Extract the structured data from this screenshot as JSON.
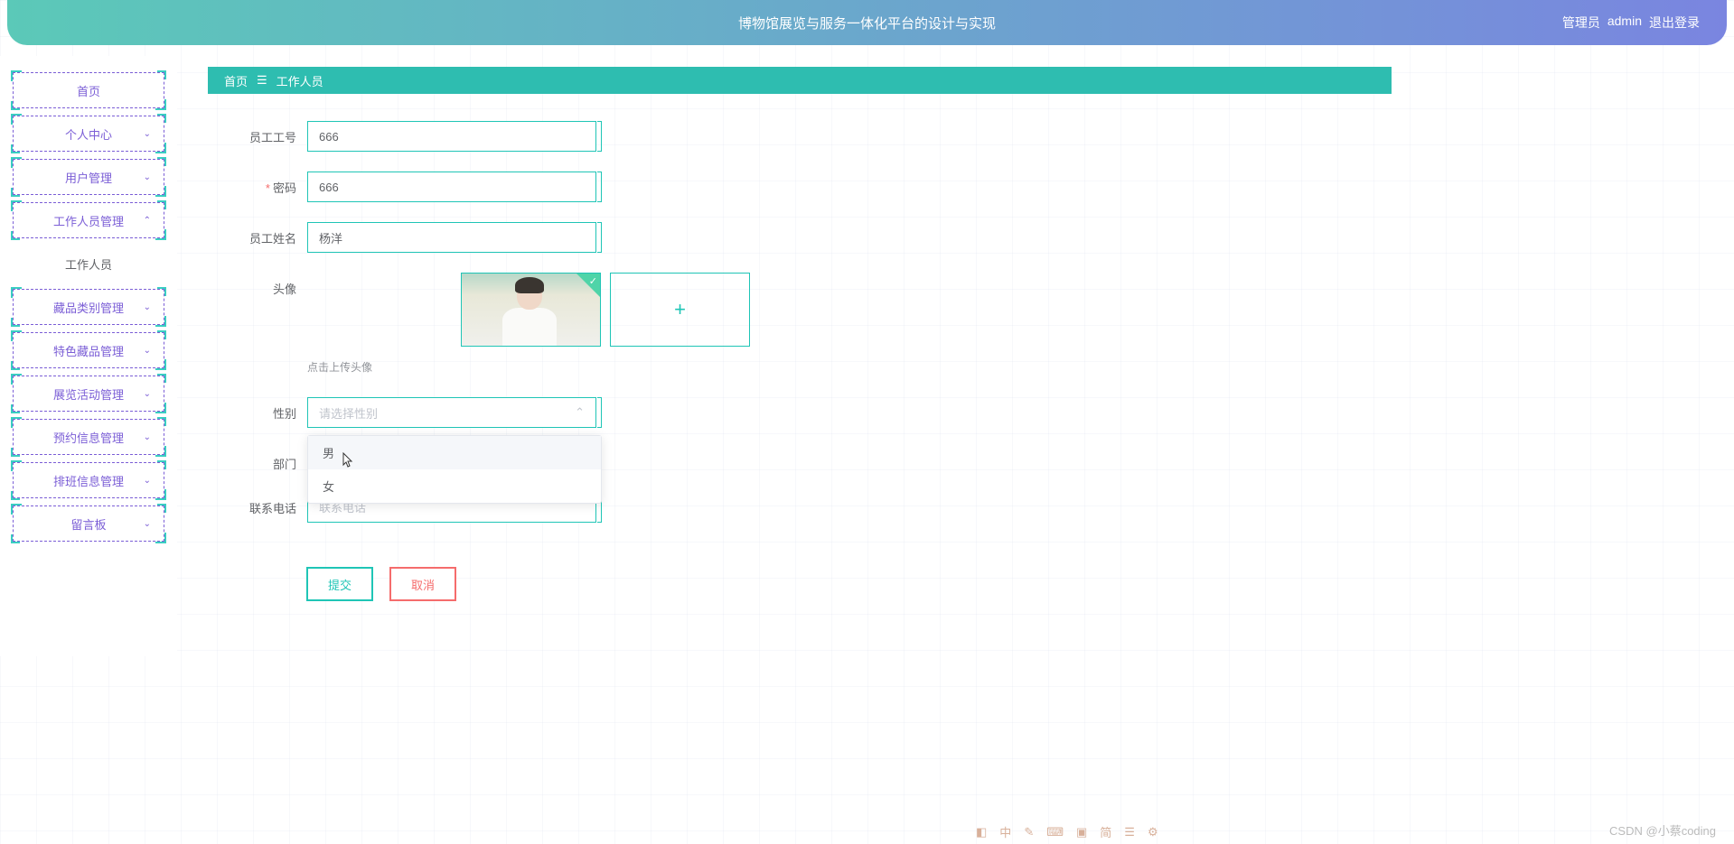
{
  "header": {
    "title": "博物馆展览与服务一体化平台的设计与实现",
    "role_label": "管理员",
    "username": "admin",
    "logout": "退出登录"
  },
  "sidebar": {
    "items": [
      {
        "label": "首页",
        "expandable": false
      },
      {
        "label": "个人中心",
        "expandable": true
      },
      {
        "label": "用户管理",
        "expandable": true
      },
      {
        "label": "工作人员管理",
        "expandable": true,
        "expanded": true
      },
      {
        "label": "工作人员",
        "expandable": false,
        "active": true
      },
      {
        "label": "藏品类别管理",
        "expandable": true
      },
      {
        "label": "特色藏品管理",
        "expandable": true
      },
      {
        "label": "展览活动管理",
        "expandable": true
      },
      {
        "label": "预约信息管理",
        "expandable": true
      },
      {
        "label": "排班信息管理",
        "expandable": true
      },
      {
        "label": "留言板",
        "expandable": true
      }
    ]
  },
  "breadcrumb": {
    "home": "首页",
    "sep": "☰",
    "current": "工作人员"
  },
  "form": {
    "employee_id": {
      "label": "员工工号",
      "value": "666"
    },
    "password": {
      "label": "密码",
      "value": "666",
      "required": true
    },
    "name": {
      "label": "员工姓名",
      "value": "杨洋"
    },
    "avatar": {
      "label": "头像",
      "hint": "点击上传头像"
    },
    "gender": {
      "label": "性别",
      "placeholder": "请选择性别",
      "options": [
        "男",
        "女"
      ]
    },
    "department": {
      "label": "部门"
    },
    "phone": {
      "label": "联系电话",
      "placeholder": "联系电话"
    },
    "submit": "提交",
    "cancel": "取消"
  },
  "watermark": "CSDN @小蔡coding",
  "ime": {
    "items": [
      "中",
      "简"
    ]
  }
}
